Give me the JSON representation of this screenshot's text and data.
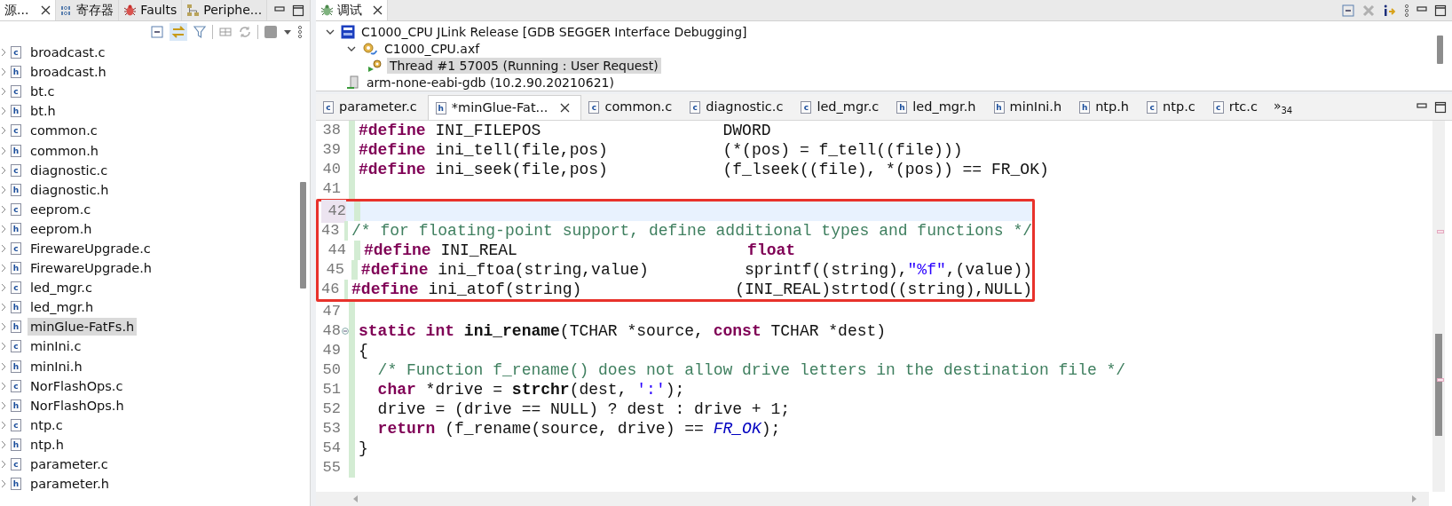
{
  "left_panel": {
    "tabs": [
      {
        "label": "源...",
        "kind": "none",
        "selected": true,
        "closable": true
      },
      {
        "label": "寄存器",
        "kind": "binary",
        "selected": false,
        "closable": false
      },
      {
        "label": "Faults",
        "kind": "bug",
        "selected": false,
        "closable": false
      },
      {
        "label": "Periphe...",
        "kind": "tree",
        "selected": false,
        "closable": false
      }
    ],
    "files": [
      {
        "name": "broadcast.c",
        "badge": "c",
        "expanded": false,
        "selected": false
      },
      {
        "name": "broadcast.h",
        "badge": "h",
        "expanded": false,
        "selected": false
      },
      {
        "name": "bt.c",
        "badge": "c",
        "expanded": false,
        "selected": false
      },
      {
        "name": "bt.h",
        "badge": "h",
        "expanded": false,
        "selected": false
      },
      {
        "name": "common.c",
        "badge": "c",
        "expanded": false,
        "selected": false
      },
      {
        "name": "common.h",
        "badge": "h",
        "expanded": false,
        "selected": false
      },
      {
        "name": "diagnostic.c",
        "badge": "c",
        "expanded": false,
        "selected": false
      },
      {
        "name": "diagnostic.h",
        "badge": "h",
        "expanded": false,
        "selected": false
      },
      {
        "name": "eeprom.c",
        "badge": "c",
        "expanded": false,
        "selected": false
      },
      {
        "name": "eeprom.h",
        "badge": "h",
        "expanded": false,
        "selected": false
      },
      {
        "name": "FirewareUpgrade.c",
        "badge": "c",
        "expanded": false,
        "selected": false
      },
      {
        "name": "FirewareUpgrade.h",
        "badge": "h",
        "expanded": false,
        "selected": false
      },
      {
        "name": "led_mgr.c",
        "badge": "c",
        "expanded": false,
        "selected": false
      },
      {
        "name": "led_mgr.h",
        "badge": "h",
        "expanded": false,
        "selected": false
      },
      {
        "name": "minGlue-FatFs.h",
        "badge": "h",
        "expanded": false,
        "selected": true
      },
      {
        "name": "minIni.c",
        "badge": "c",
        "expanded": false,
        "selected": false
      },
      {
        "name": "minIni.h",
        "badge": "h",
        "expanded": false,
        "selected": false
      },
      {
        "name": "NorFlashOps.c",
        "badge": "c",
        "expanded": false,
        "selected": false
      },
      {
        "name": "NorFlashOps.h",
        "badge": "h",
        "expanded": false,
        "selected": false
      },
      {
        "name": "ntp.c",
        "badge": "c",
        "expanded": false,
        "selected": false
      },
      {
        "name": "ntp.h",
        "badge": "h",
        "expanded": false,
        "selected": false
      },
      {
        "name": "parameter.c",
        "badge": "c",
        "expanded": false,
        "selected": false
      },
      {
        "name": "parameter.h",
        "badge": "h",
        "expanded": false,
        "selected": false
      }
    ]
  },
  "debug_panel": {
    "tab": {
      "label": "调试",
      "selected": true,
      "closable": true
    },
    "tree": [
      {
        "label": "C1000_CPU JLink Release [GDB SEGGER Interface Debugging]",
        "kind": "launch",
        "expanded": true,
        "selected": false,
        "children": [
          {
            "label": "C1000_CPU.axf",
            "kind": "process",
            "expanded": true,
            "selected": false,
            "children": [
              {
                "label": "Thread #1 57005 (Running : User Request)",
                "kind": "thread",
                "selected": true
              }
            ]
          },
          {
            "label": "arm-none-eabi-gdb (10.2.90.20210621)",
            "kind": "debugger",
            "selected": false
          }
        ]
      }
    ]
  },
  "editor": {
    "tabs": [
      {
        "label": "parameter.c",
        "badge": "c",
        "selected": false,
        "closable": false
      },
      {
        "label": "*minGlue-Fat...",
        "badge": "h",
        "selected": true,
        "closable": true
      },
      {
        "label": "common.c",
        "badge": "c",
        "selected": false,
        "closable": false
      },
      {
        "label": "diagnostic.c",
        "badge": "c",
        "selected": false,
        "closable": false
      },
      {
        "label": "led_mgr.c",
        "badge": "c",
        "selected": false,
        "closable": false
      },
      {
        "label": "led_mgr.h",
        "badge": "h",
        "selected": false,
        "closable": false
      },
      {
        "label": "minIni.h",
        "badge": "h",
        "selected": false,
        "closable": false
      },
      {
        "label": "ntp.h",
        "badge": "h",
        "selected": false,
        "closable": false
      },
      {
        "label": "ntp.c",
        "badge": "c",
        "selected": false,
        "closable": false
      },
      {
        "label": "rtc.c",
        "badge": "c",
        "selected": false,
        "closable": false
      }
    ],
    "overflow": {
      "mark": "»",
      "count": "34"
    },
    "code": {
      "lines_before": [
        {
          "number": "38",
          "current": false,
          "fold": false,
          "tokens": [
            {
              "kind": "kw",
              "text": "#define"
            },
            {
              "kind": "plain",
              "text": " INI_FILEPOS                   DWORD"
            }
          ]
        },
        {
          "number": "39",
          "current": false,
          "fold": false,
          "tokens": [
            {
              "kind": "kw",
              "text": "#define"
            },
            {
              "kind": "plain",
              "text": " ini_tell(file,pos)            (*(pos) = f_tell((file)))"
            }
          ]
        },
        {
          "number": "40",
          "current": false,
          "fold": false,
          "tokens": [
            {
              "kind": "kw",
              "text": "#define"
            },
            {
              "kind": "plain",
              "text": " ini_seek(file,pos)            (f_lseek((file), *(pos)) == FR_OK)"
            }
          ]
        },
        {
          "number": "41",
          "current": false,
          "fold": false
        }
      ],
      "boxed_lines": [
        {
          "number": "42",
          "current": true,
          "fold": false
        },
        {
          "number": "43",
          "current": false,
          "fold": false,
          "tokens": [
            {
              "kind": "comment",
              "text": "/* for floating-point support, define additional types and functions */"
            }
          ]
        },
        {
          "number": "44",
          "current": false,
          "fold": false,
          "tokens": [
            {
              "kind": "kw",
              "text": "#define"
            },
            {
              "kind": "plain",
              "text": " INI_REAL                        "
            },
            {
              "kind": "kw",
              "text": "float"
            }
          ]
        },
        {
          "number": "45",
          "current": false,
          "fold": false,
          "tokens": [
            {
              "kind": "kw",
              "text": "#define"
            },
            {
              "kind": "plain",
              "text": " ini_ftoa(string,value)          sprintf((string),"
            },
            {
              "kind": "string",
              "text": "\"%f\""
            },
            {
              "kind": "plain",
              "text": ",(value))"
            }
          ]
        },
        {
          "number": "46",
          "current": false,
          "fold": false,
          "tokens": [
            {
              "kind": "kw",
              "text": "#define"
            },
            {
              "kind": "plain",
              "text": " ini_atof(string)                (INI_REAL)strtod((string),NULL)"
            }
          ]
        }
      ],
      "lines_after": [
        {
          "number": "47",
          "current": false,
          "fold": false
        },
        {
          "number": "48",
          "current": false,
          "fold": true,
          "tokens": [
            {
              "kind": "kw",
              "text": "static int"
            },
            {
              "kind": "fn",
              "text": " ini_rename"
            },
            {
              "kind": "plain",
              "text": "(TCHAR *source, "
            },
            {
              "kind": "kw",
              "text": "const"
            },
            {
              "kind": "plain",
              "text": " TCHAR *dest)"
            }
          ]
        },
        {
          "number": "49",
          "current": false,
          "fold": false,
          "tokens": [
            {
              "kind": "plain",
              "text": "{"
            }
          ]
        },
        {
          "number": "50",
          "current": false,
          "fold": false,
          "tokens": [
            {
              "kind": "comment",
              "text": "  /* Function f_rename() does not allow drive letters in the destination file */"
            }
          ]
        },
        {
          "number": "51",
          "current": false,
          "fold": false,
          "tokens": [
            {
              "kind": "kw",
              "text": "  char"
            },
            {
              "kind": "plain",
              "text": " *drive = "
            },
            {
              "kind": "fn",
              "text": "strchr"
            },
            {
              "kind": "plain",
              "text": "(dest, "
            },
            {
              "kind": "string",
              "text": "':'"
            },
            {
              "kind": "plain",
              "text": ");"
            }
          ]
        },
        {
          "number": "52",
          "current": false,
          "fold": false,
          "tokens": [
            {
              "kind": "plain",
              "text": "  drive = (drive == NULL) ? dest : drive + 1;"
            }
          ]
        },
        {
          "number": "53",
          "current": false,
          "fold": false,
          "tokens": [
            {
              "kind": "kw",
              "text": "  return"
            },
            {
              "kind": "plain",
              "text": " (f_rename(source, drive) == "
            },
            {
              "kind": "macro",
              "text": "FR_OK"
            },
            {
              "kind": "plain",
              "text": ");"
            }
          ]
        },
        {
          "number": "54",
          "current": false,
          "fold": false,
          "tokens": [
            {
              "kind": "plain",
              "text": "}"
            }
          ]
        },
        {
          "number": "55",
          "current": false,
          "fold": false
        }
      ]
    }
  }
}
